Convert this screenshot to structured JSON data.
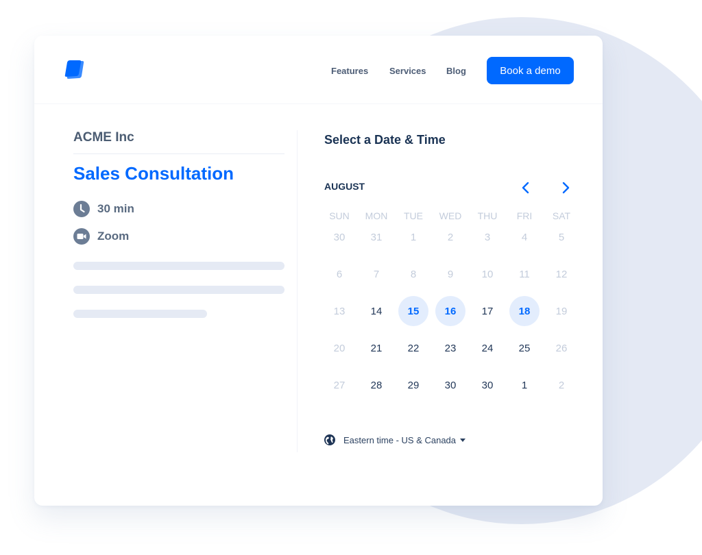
{
  "header": {
    "logo": "logo-icon",
    "nav": [
      "Features",
      "Services",
      "Blog"
    ],
    "cta_label": "Book a demo"
  },
  "event": {
    "company": "ACME Inc",
    "title": "Sales Consultation",
    "duration": "30 min",
    "location": "Zoom",
    "duration_icon": "clock-icon",
    "location_icon": "video-camera-icon"
  },
  "calendar": {
    "title": "Select a Date & Time",
    "month": "AUGUST",
    "weekdays": [
      "SUN",
      "MON",
      "TUE",
      "WED",
      "THU",
      "FRI",
      "SAT"
    ],
    "weeks": [
      [
        {
          "d": "30",
          "s": "disabled"
        },
        {
          "d": "31",
          "s": "disabled"
        },
        {
          "d": "1",
          "s": "disabled"
        },
        {
          "d": "2",
          "s": "disabled"
        },
        {
          "d": "3",
          "s": "disabled"
        },
        {
          "d": "4",
          "s": "disabled"
        },
        {
          "d": "5",
          "s": "disabled"
        }
      ],
      [
        {
          "d": "6",
          "s": "disabled"
        },
        {
          "d": "7",
          "s": "disabled"
        },
        {
          "d": "8",
          "s": "disabled"
        },
        {
          "d": "9",
          "s": "disabled"
        },
        {
          "d": "10",
          "s": "disabled"
        },
        {
          "d": "11",
          "s": "disabled"
        },
        {
          "d": "12",
          "s": "disabled"
        }
      ],
      [
        {
          "d": "13",
          "s": "disabled"
        },
        {
          "d": "14",
          "s": "enabled"
        },
        {
          "d": "15",
          "s": "available"
        },
        {
          "d": "16",
          "s": "available"
        },
        {
          "d": "17",
          "s": "enabled"
        },
        {
          "d": "18",
          "s": "available"
        },
        {
          "d": "19",
          "s": "disabled"
        }
      ],
      [
        {
          "d": "20",
          "s": "disabled"
        },
        {
          "d": "21",
          "s": "enabled"
        },
        {
          "d": "22",
          "s": "enabled"
        },
        {
          "d": "23",
          "s": "enabled"
        },
        {
          "d": "24",
          "s": "enabled"
        },
        {
          "d": "25",
          "s": "enabled"
        },
        {
          "d": "26",
          "s": "disabled"
        }
      ],
      [
        {
          "d": "27",
          "s": "disabled"
        },
        {
          "d": "28",
          "s": "enabled"
        },
        {
          "d": "29",
          "s": "enabled"
        },
        {
          "d": "30",
          "s": "enabled"
        },
        {
          "d": "30",
          "s": "enabled"
        },
        {
          "d": "1",
          "s": "enabled"
        },
        {
          "d": "2",
          "s": "disabled"
        }
      ]
    ],
    "timezone": "Eastern time - US & Canada"
  },
  "colors": {
    "accent": "#0069ff",
    "available_bg": "#e3edfd",
    "text_dark": "#1a3354",
    "text_muted": "#c3ccdb"
  }
}
